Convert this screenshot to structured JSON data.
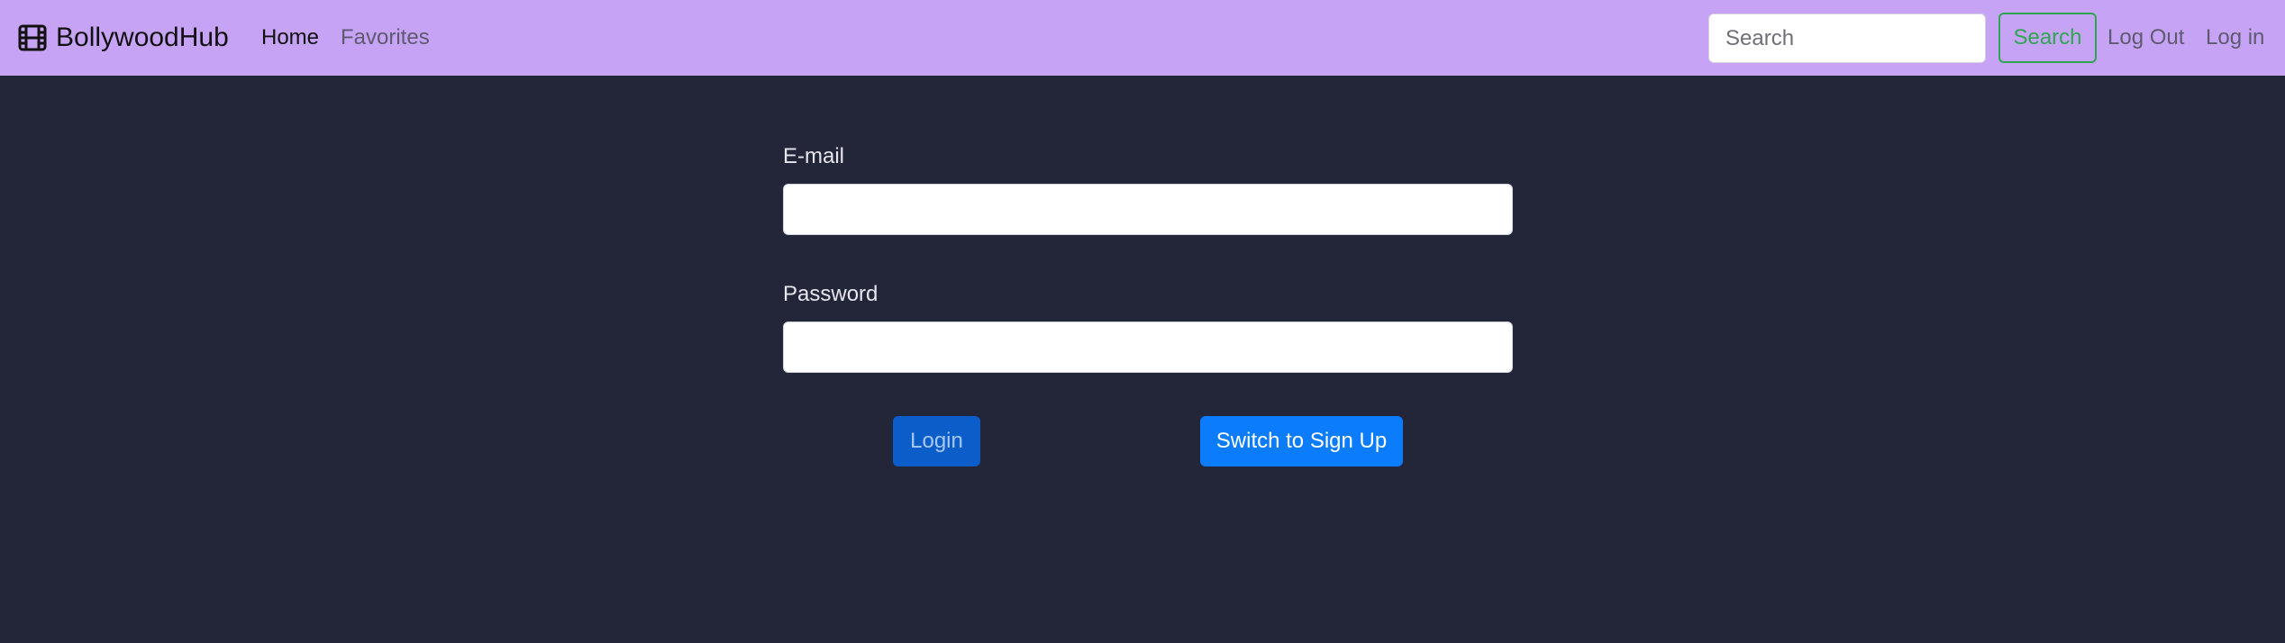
{
  "navbar": {
    "brand": {
      "label": "BollywoodHub",
      "icon": "film-icon"
    },
    "links": [
      {
        "label": "Home",
        "active": true
      },
      {
        "label": "Favorites",
        "active": false
      }
    ],
    "search": {
      "placeholder": "Search",
      "value": "",
      "button_label": "Search"
    },
    "logout_label": "Log Out",
    "login_label": "Log in"
  },
  "form": {
    "email": {
      "label": "E-mail",
      "value": ""
    },
    "password": {
      "label": "Password",
      "value": ""
    },
    "login_button": "Login",
    "switch_button": "Switch to Sign Up"
  },
  "colors": {
    "navbar_background": "#c6a3f5",
    "page_background": "#232639",
    "search_button": "#30a652",
    "primary_button": "#0b7cfc",
    "login_button": "#0b5ec9"
  }
}
